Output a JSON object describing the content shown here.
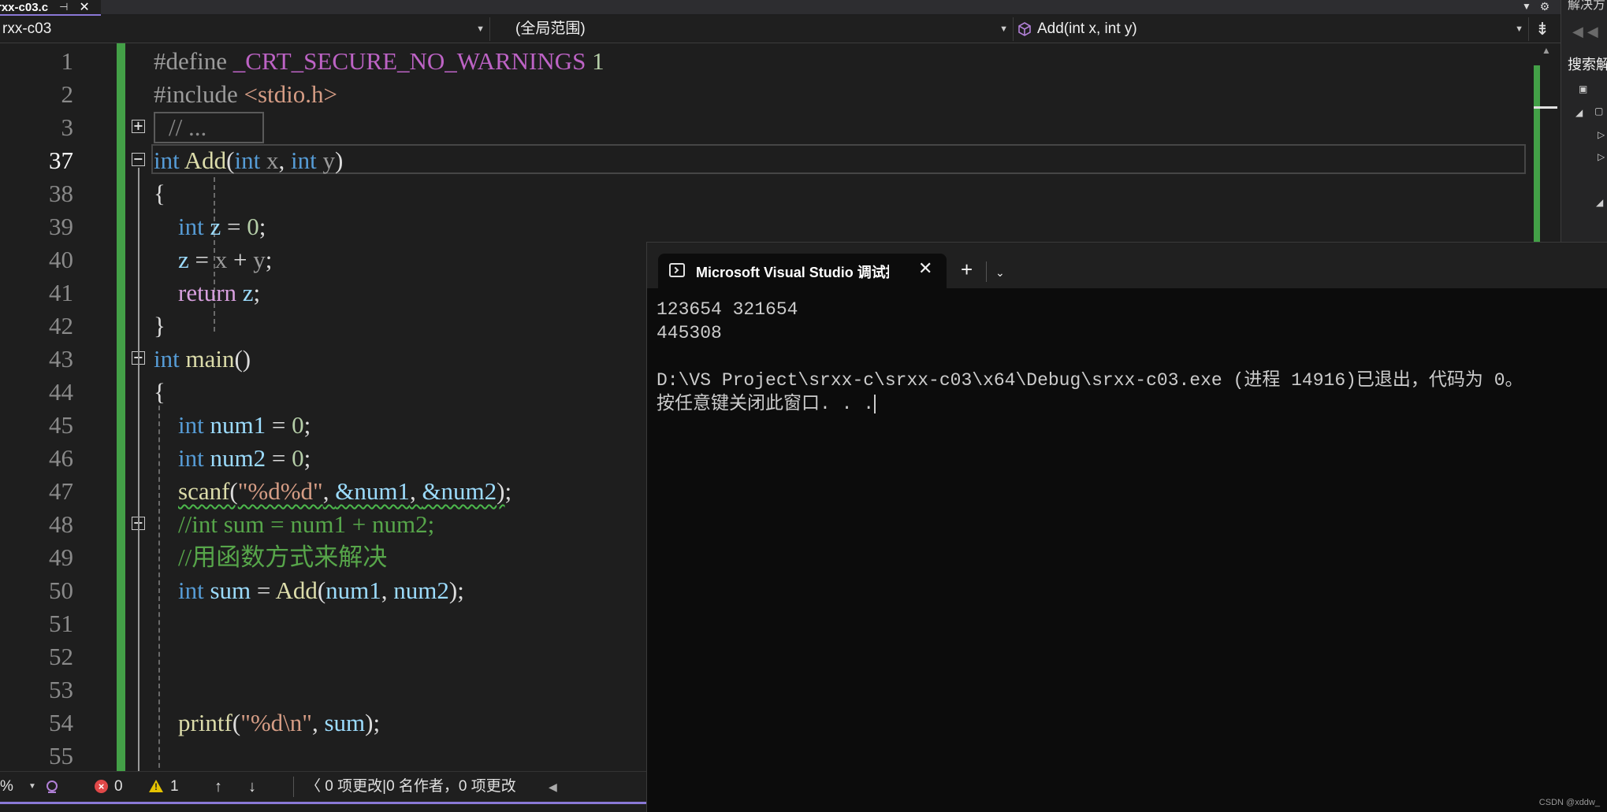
{
  "tab": {
    "file_name": "rxx-c03.c",
    "pin_glyph": "⊣",
    "close_glyph": "✕"
  },
  "navbar": {
    "project": "rxx-c03",
    "scope": "(全局范围)",
    "function": "Add(int x, int y)"
  },
  "editor": {
    "line_numbers": [
      "1",
      "2",
      "3",
      "37",
      "38",
      "39",
      "40",
      "41",
      "42",
      "43",
      "44",
      "45",
      "46",
      "47",
      "48",
      "49",
      "50",
      "51",
      "52",
      "53",
      "54",
      "55"
    ],
    "current_line": "37",
    "collapsed_region": "// ...",
    "lines": {
      "l1": {
        "directive": "#define",
        "macro": "_CRT_SECURE_NO_WARNINGS",
        "value": "1"
      },
      "l2": {
        "directive": "#include",
        "header": "<stdio.h>"
      },
      "l37": {
        "kw": "int",
        "name": "Add",
        "p1": "int",
        "a1": "x",
        "p2": "int",
        "a2": "y"
      },
      "l39": {
        "kw": "int",
        "var": "z",
        "val": "0"
      },
      "l40": {
        "z": "z",
        "x": "x",
        "y": "y"
      },
      "l41": {
        "kw": "return",
        "var": "z"
      },
      "l43": {
        "kw": "int",
        "name": "main"
      },
      "l45": {
        "kw": "int",
        "var": "num1",
        "val": "0"
      },
      "l46": {
        "kw": "int",
        "var": "num2",
        "val": "0"
      },
      "l47": {
        "fn": "scanf",
        "fmt": "\"%d%d\"",
        "a1": "&num1",
        "a2": "&num2"
      },
      "l48": "//int sum = num1 + num2;",
      "l49": "//用函数方式来解决",
      "l50": {
        "kw": "int",
        "var": "sum",
        "fn": "Add",
        "a1": "num1",
        "a2": "num2"
      },
      "l54": {
        "fn": "printf",
        "fmt": "\"%d\\n\"",
        "a1": "sum"
      }
    }
  },
  "solution_explorer": {
    "title": "解决方",
    "search": "搜索解"
  },
  "statusbar": {
    "zoom": "%",
    "errors": "0",
    "warnings": "1",
    "changes": "0 项更改|0 名作者，0 项更改"
  },
  "console": {
    "tab_title": "Microsoft Visual Studio 调试控制台",
    "output_line1": "123654 321654",
    "output_line2": "445308",
    "output_line3": "",
    "output_line4": "D:\\VS Project\\srxx-c\\srxx-c03\\x64\\Debug\\srxx-c03.exe (进程 14916)已退出，代码为 0。",
    "output_line5": "按任意键关闭此窗口. . .",
    "watermark": "CSDN @xddw_"
  },
  "colors": {
    "keyword": "#569cd6",
    "function": "#dcdcaa",
    "string": "#d69d85",
    "number": "#b5cea8",
    "variable": "#9cdcfe",
    "comment": "#57a64a",
    "change_bar": "#43a047",
    "accent": "#8a78d6"
  },
  "icons": [
    "pin-icon",
    "close-icon",
    "cube-icon",
    "split-icon",
    "plus-icon",
    "minus-icon",
    "error-icon",
    "warning-icon",
    "arrow-up-icon",
    "arrow-down-icon",
    "terminal-icon",
    "chevron-down-icon"
  ]
}
